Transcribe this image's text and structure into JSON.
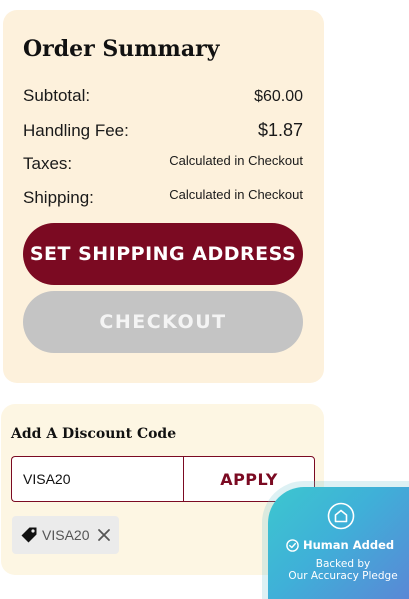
{
  "order_summary": {
    "title": "Order Summary",
    "rows": [
      {
        "label": "Subtotal:",
        "value": "$60.00"
      },
      {
        "label": "Handling Fee:",
        "value": "$1.87"
      },
      {
        "label": "Taxes:",
        "value": "Calculated in Checkout"
      },
      {
        "label": "Shipping:",
        "value": "Calculated in Checkout"
      }
    ],
    "set_shipping_label": "SET SHIPPING ADDRESS",
    "checkout_label": "CHECKOUT"
  },
  "discount": {
    "title": "Add A Discount Code",
    "input_value": "VISA20",
    "apply_label": "APPLY",
    "applied_code": "VISA20"
  },
  "badge": {
    "line1": "Human Added",
    "line2": "Backed by",
    "line3": "Our Accuracy Pledge"
  },
  "colors": {
    "brand": "#7b0a22",
    "summary_bg": "#fdf1dc",
    "disabled_button": "#c4c4c4",
    "badge_gradient": [
      "#3cc7cf",
      "#5a87d6"
    ]
  }
}
